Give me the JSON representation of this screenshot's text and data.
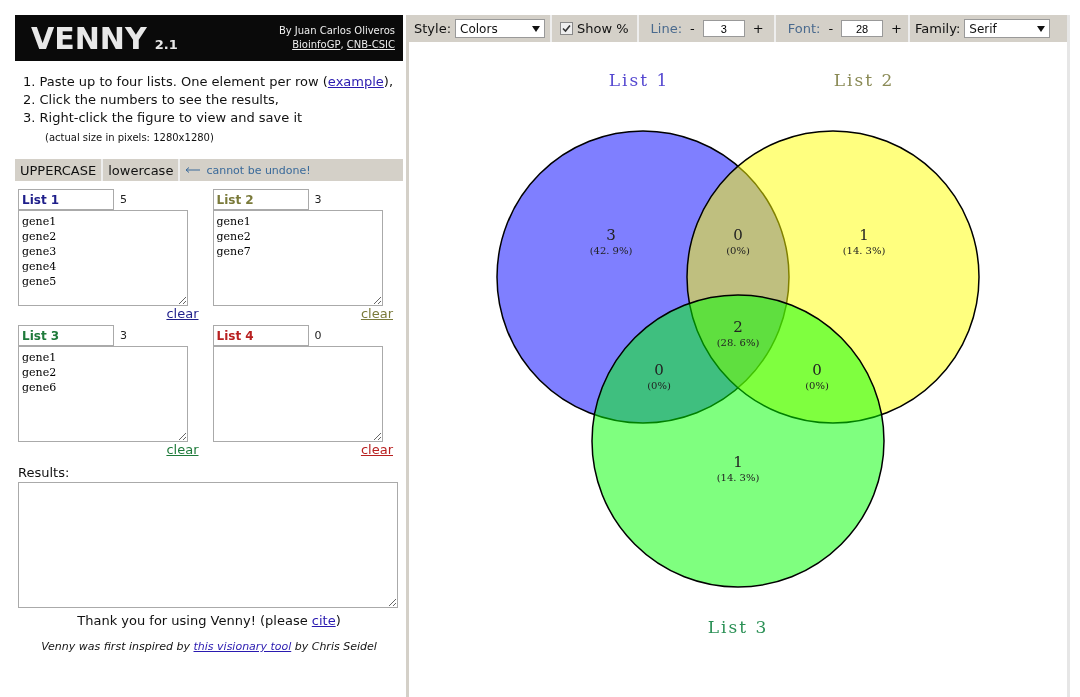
{
  "header": {
    "logo": "VENNY",
    "version": "2.1",
    "author": "By Juan Carlos Oliveros",
    "links": [
      "BioinfoGP",
      "CNB-CSIC"
    ],
    "link_separator": ","
  },
  "instructions": [
    {
      "text": "1. Paste up to four lists. One element per row (",
      "link": "example",
      "tail": "),"
    },
    {
      "text": "2. Click the numbers to see the results,"
    },
    {
      "text": "3. Right-click the figure to view and save it"
    }
  ],
  "size_note": "(actual size in pixels: 1280x1280)",
  "case_bar": {
    "buttons": [
      "UPPERCASE",
      "lowercase"
    ],
    "warning": "cannot be undone!"
  },
  "lists": [
    {
      "name": "List 1",
      "count": "5",
      "items": "gene1\ngene2\ngene3\ngene4\ngene5",
      "clear": "clear",
      "color": "#1e1e8a"
    },
    {
      "name": "List 2",
      "count": "3",
      "items": "gene1\ngene2\ngene7",
      "clear": "clear",
      "color": "#7a7a3a"
    },
    {
      "name": "List 3",
      "count": "3",
      "items": "gene1\ngene2\ngene6",
      "clear": "clear",
      "color": "#1e7a3a"
    },
    {
      "name": "List 4",
      "count": "0",
      "clear": "clear",
      "color": "#b82020"
    }
  ],
  "results": {
    "label": "Results:"
  },
  "thanks": {
    "text": "Thank you for using Venny!  (please ",
    "link": "cite",
    "tail": ")"
  },
  "credit": {
    "text": "Venny was first inspired by ",
    "link": "this visionary tool",
    "tail": " by Chris Seidel"
  },
  "toolbar": {
    "style_label": "Style:",
    "style_value": "Colors",
    "show_percent": {
      "label": "Show %",
      "checked": true
    },
    "line_label": "Line:",
    "line_value": "3",
    "font_label": "Font:",
    "font_value": "28",
    "minus": "-",
    "plus": "+",
    "family_label": "Family:",
    "family_value": "Serif"
  },
  "venn": {
    "sets": [
      {
        "label": "List 1",
        "color": "#5548d0"
      },
      {
        "label": "List 2",
        "color": "#8a8a55"
      },
      {
        "label": "List 3",
        "color": "#2a9055"
      }
    ],
    "regions": [
      {
        "count": "3",
        "percent": "(42. 9%)"
      },
      {
        "count": "0",
        "percent": "(0%)"
      },
      {
        "count": "1",
        "percent": "(14. 3%)"
      },
      {
        "count": "2",
        "percent": "(28. 6%)"
      },
      {
        "count": "0",
        "percent": "(0%)"
      },
      {
        "count": "0",
        "percent": "(0%)"
      },
      {
        "count": "1",
        "percent": "(14. 3%)"
      }
    ]
  }
}
